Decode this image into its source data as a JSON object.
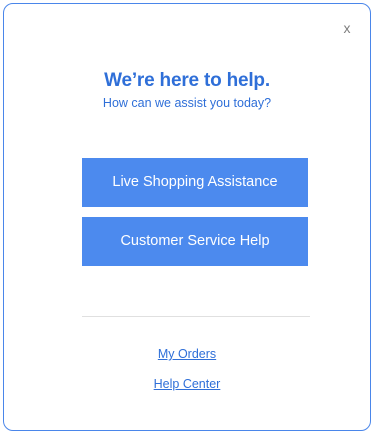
{
  "dialog": {
    "close_label": "x",
    "title": "We’re here to help.",
    "subtitle": "How can we assist you today?",
    "buttons": [
      {
        "label": "Live Shopping Assistance"
      },
      {
        "label": "Customer Service Help"
      }
    ],
    "links": [
      {
        "label": "My Orders"
      },
      {
        "label": "Help Center"
      }
    ]
  },
  "colors": {
    "accent": "#4c8aee",
    "text_blue": "#2f6fd8",
    "border": "#4a86ea"
  }
}
